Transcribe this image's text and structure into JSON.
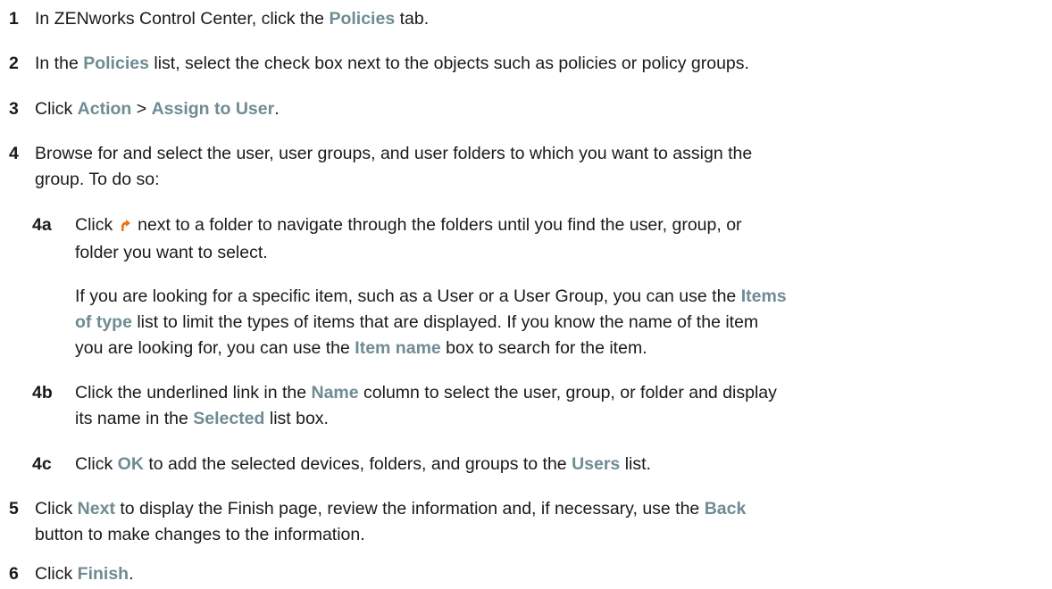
{
  "steps": [
    {
      "num": "1",
      "parts": [
        {
          "t": "In ZENworks Control Center, click the "
        },
        {
          "t": "Policies",
          "ui": true
        },
        {
          "t": " tab."
        }
      ]
    },
    {
      "num": "2",
      "parts": [
        {
          "t": "In the "
        },
        {
          "t": "Policies",
          "ui": true
        },
        {
          "t": " list, select the check box next to the objects such as policies or policy groups."
        }
      ]
    },
    {
      "num": "3",
      "parts": [
        {
          "t": "Click "
        },
        {
          "t": "Action",
          "ui": true
        },
        {
          "t": " > "
        },
        {
          "t": "Assign to User",
          "ui": true
        },
        {
          "t": "."
        }
      ]
    },
    {
      "num": "4",
      "line1": "Browse for and select the user, user groups, and user folders to which you want to assign the",
      "line2": "group. To do so:"
    },
    {
      "num": "5",
      "line1_parts": [
        {
          "t": "Click "
        },
        {
          "t": "Next",
          "ui": true
        },
        {
          "t": " to display the Finish page, review the information and, if necessary, use the "
        },
        {
          "t": "Back",
          "ui": true
        }
      ],
      "line2": "button to make changes to the information."
    },
    {
      "num": "6",
      "parts": [
        {
          "t": "Click "
        },
        {
          "t": "Finish",
          "ui": true
        },
        {
          "t": "."
        }
      ]
    }
  ],
  "substeps": {
    "a": {
      "num": "4a",
      "line1_before": "Click",
      "icon": "browse-arrow-icon",
      "line1_after": "next to a folder to navigate through the folders until you find the user, group, or",
      "line2": "folder you want to select.",
      "para_line1": "If you are looking for a specific item, such as a User or a User Group, you can use the",
      "para_ui1a": "Items",
      "para_ui1b": "of type",
      "para_line2": " list to limit the types of items that are displayed. If you know the name of the item",
      "para_line3_before": "you are looking for, you can use the ",
      "para_ui2": "Item name",
      "para_line3_after": " box to search for the item."
    },
    "b": {
      "num": "4b",
      "line1_before": "Click the underlined link in the ",
      "ui1": "Name",
      "line1_after": " column to select the user, group, or folder and display",
      "line2_before": "its name in the ",
      "ui2": "Selected",
      "line2_after": " list box."
    },
    "c": {
      "num": "4c",
      "line1_before": "Click ",
      "ui1": "OK",
      "line1_mid": " to add the selected devices, folders, and groups to the ",
      "ui2": "Users",
      "line1_after": " list."
    }
  },
  "colors": {
    "ui_term": "#6f8b94",
    "icon": "#e8731a",
    "text": "#1a1a1a"
  }
}
